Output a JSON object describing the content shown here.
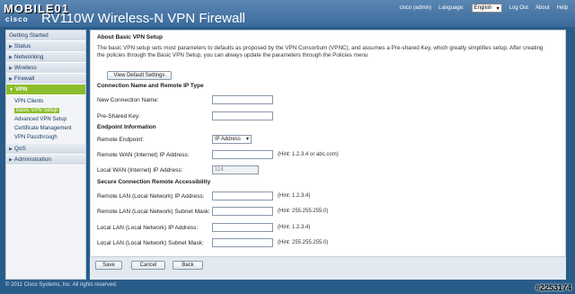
{
  "header": {
    "logo": "MOBILE01",
    "brand": "cisco",
    "product": "RV110W Wireless-N VPN Firewall",
    "user": "cisco (admin)",
    "language_label": "Language:",
    "language_value": "English",
    "logout": "Log Out",
    "about": "About",
    "help": "Help"
  },
  "sidebar": {
    "items": [
      {
        "label": "Getting Started"
      },
      {
        "label": "Status"
      },
      {
        "label": "Networking"
      },
      {
        "label": "Wireless"
      },
      {
        "label": "Firewall"
      },
      {
        "label": "VPN"
      },
      {
        "label": "QoS"
      },
      {
        "label": "Administration"
      }
    ],
    "vpn_sub": [
      {
        "label": "VPN Clients"
      },
      {
        "label": "Basic VPN Setup"
      },
      {
        "label": "Advanced VPN Setup"
      },
      {
        "label": "Certificate Management"
      },
      {
        "label": "VPN Passthrough"
      }
    ]
  },
  "main": {
    "about_title": "About Basic VPN Setup",
    "about_text": "The basic VPN setup sets most parameters to defaults as proposed by the VPN Consortium (VPNC), and assumes a Pre-shared Key, which greatly simplifies setup. After creating the policies through the Basic VPN Setup, you can always update the parameters through the Policies menu",
    "view_defaults": "View Default Settings",
    "conn_title": "Connection Name and Remote IP Type",
    "new_conn_label": "New Connection Name:",
    "psk_label": "Pre-Shared Key:",
    "endpoint_title": "Endpoint Information",
    "remote_endpoint_label": "Remote Endpoint:",
    "remote_endpoint_value": "IP Address",
    "remote_wan_label": "Remote WAN (Internet) IP Address:",
    "remote_wan_hint": "(Hint: 1.2.3.4 or abc.com)",
    "local_wan_label": "Local WAN (Internet) IP Address:",
    "local_wan_value": "114.",
    "secure_title": "Secure Connection Remote Accessibility",
    "remote_lan_ip_label": "Remote LAN (Local Network) IP Address:",
    "remote_lan_ip_hint": "(Hint: 1.2.3.4)",
    "remote_lan_mask_label": "Remote LAN (Local Network) Subnet Mask:",
    "remote_lan_mask_hint": "(Hint: 255.255.255.0)",
    "local_lan_ip_label": "Local LAN (Local Network) IP Address:",
    "local_lan_ip_hint": "(Hint: 1.2.3.4)",
    "local_lan_mask_label": "Local LAN (Local Network) Subnet Mask:",
    "local_lan_mask_hint": "(Hint: 255.255.255.0)",
    "save": "Save",
    "cancel": "Cancel",
    "back": "Back"
  },
  "footer": "© 2011 Cisco Systems, Inc. All rights reserved.",
  "watermark": "#2253174"
}
